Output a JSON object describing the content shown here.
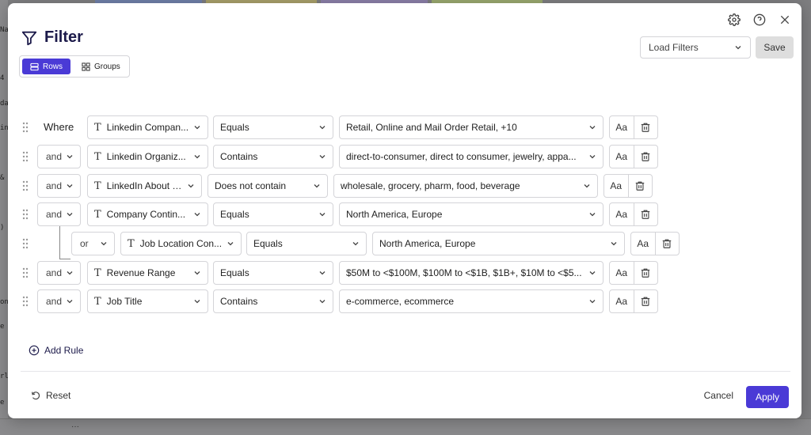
{
  "background": {
    "left_fragments": [
      "Na",
      "4",
      "da",
      "in",
      "&",
      ")",
      "on",
      "e",
      "rl",
      "e"
    ],
    "bottom_ellipsis": "···"
  },
  "header": {
    "title": "Filter",
    "view_toggle": {
      "rows_label": "Rows",
      "groups_label": "Groups",
      "active": "Rows"
    },
    "load_filters_placeholder": "Load Filters",
    "save_label": "Save"
  },
  "rules": [
    {
      "conjunction": "Where",
      "field": "Linkedin Compan...",
      "operator": "Equals",
      "value": "Retail, Online and Mail Order Retail, +10",
      "case_label": "Aa"
    },
    {
      "conjunction": "and",
      "field": "Linkedin Organiz...",
      "operator": "Contains",
      "value": "direct-to-consumer, direct to consumer, jewelry, appa...",
      "case_label": "Aa"
    },
    {
      "conjunction": "and",
      "field": "LinkedIn About Us",
      "operator": "Does not contain",
      "value": "wholesale, grocery, pharm, food, beverage",
      "case_label": "Aa"
    },
    {
      "conjunction": "and",
      "field": "Company Contin...",
      "operator": "Equals",
      "value": "North America, Europe",
      "case_label": "Aa"
    },
    {
      "conjunction": "or",
      "field": "Job Location Con...",
      "operator": "Equals",
      "value": "North America, Europe",
      "case_label": "Aa",
      "nested": true
    },
    {
      "conjunction": "and",
      "field": "Revenue Range",
      "operator": "Equals",
      "value": "$50M to <$100M, $100M to <$1B, $1B+, $10M to <$5...",
      "case_label": "Aa"
    },
    {
      "conjunction": "and",
      "field": "Job Title",
      "operator": "Contains",
      "value": "e-commerce, ecommerce",
      "case_label": "Aa"
    }
  ],
  "footer": {
    "add_rule_label": "Add Rule",
    "reset_label": "Reset",
    "cancel_label": "Cancel",
    "apply_label": "Apply"
  },
  "colors": {
    "accent": "#4a3ad6",
    "title": "#1c1a4a",
    "border": "#d4d4d8"
  }
}
